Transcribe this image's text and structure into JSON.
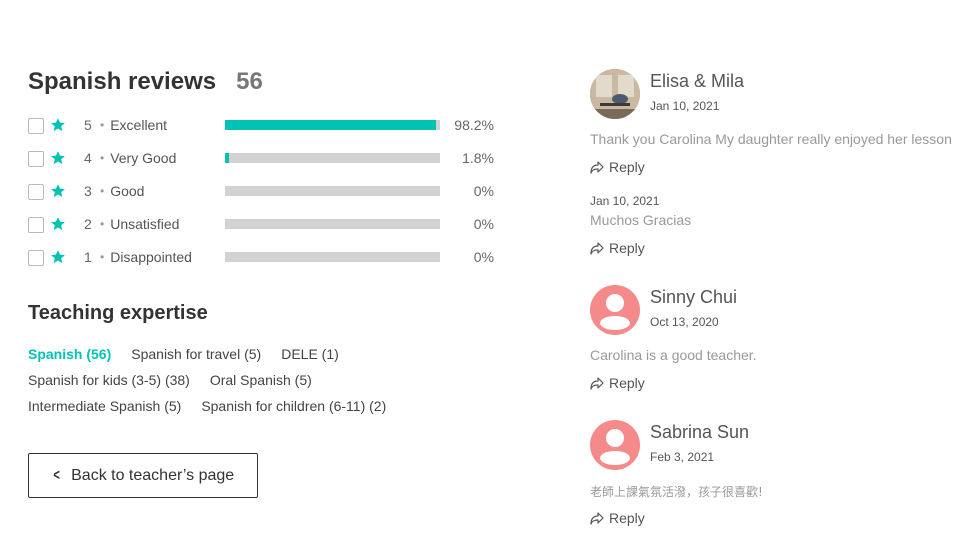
{
  "reviews_summary": {
    "title": "Spanish reviews",
    "count": "56",
    "ratings": [
      {
        "stars": "5",
        "label": "Excellent",
        "percent_text": "98.2%",
        "fraction": 0.982
      },
      {
        "stars": "4",
        "label": "Very Good",
        "percent_text": "1.8%",
        "fraction": 0.018
      },
      {
        "stars": "3",
        "label": "Good",
        "percent_text": "0%",
        "fraction": 0
      },
      {
        "stars": "2",
        "label": "Unsatisfied",
        "percent_text": "0%",
        "fraction": 0
      },
      {
        "stars": "1",
        "label": "Disappointed",
        "percent_text": "0%",
        "fraction": 0
      }
    ]
  },
  "expertise": {
    "title": "Teaching expertise",
    "tags": [
      {
        "label": "Spanish (56)",
        "active": true
      },
      {
        "label": "Spanish for travel (5)",
        "active": false
      },
      {
        "label": "DELE (1)",
        "active": false
      },
      {
        "label": "Spanish for kids (3-5) (38)",
        "active": false
      },
      {
        "label": "Oral Spanish (5)",
        "active": false
      },
      {
        "label": "Intermediate Spanish (5)",
        "active": false
      },
      {
        "label": "Spanish for children (6-11) (2)",
        "active": false
      }
    ]
  },
  "back_button": {
    "label": "Back to teacher’s page"
  },
  "reviews": [
    {
      "name": "Elisa & Mila",
      "date": "Jan 10, 2021",
      "text": "Thank you Carolina My daughter really enjoyed her lesson",
      "avatar": "photo",
      "reply_label": "Reply",
      "teacher_reply": {
        "date": "Jan 10, 2021",
        "text": "Muchos Gracias",
        "reply_label": "Reply"
      }
    },
    {
      "name": "Sinny Chui",
      "date": "Oct 13, 2020",
      "text": "Carolina is a good teacher.",
      "avatar": "default",
      "reply_label": "Reply"
    },
    {
      "name": "Sabrina Sun",
      "date": "Feb 3, 2021",
      "text": "老師上課氣氛活潑，孩子很喜歡!",
      "avatar": "default",
      "reply_label": "Reply"
    }
  ],
  "colors": {
    "accent": "#00c3b6",
    "bar_empty": "#d2d2d2",
    "avatar_default": "#f48a8a"
  }
}
